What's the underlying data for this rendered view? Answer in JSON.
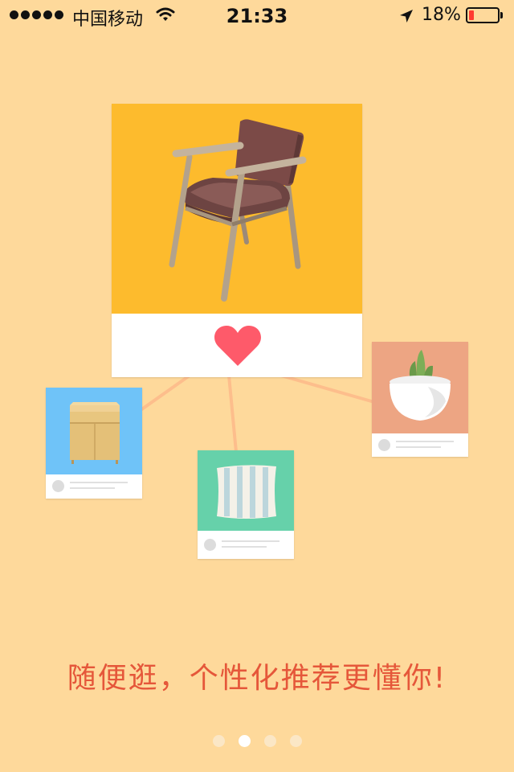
{
  "status_bar": {
    "carrier": "中国移动",
    "time": "21:33",
    "battery_percent": "18%",
    "battery_level": 0.18,
    "signal_bars": 5,
    "icons": [
      "signal-dots-icon",
      "wifi-icon",
      "location-arrow-icon",
      "battery-icon"
    ]
  },
  "onboarding": {
    "tagline": "随便逛，个性化推荐更懂你!",
    "page_count": 4,
    "active_page": 1
  },
  "cards": {
    "main": {
      "image": "armchair",
      "action_icon": "heart-icon"
    },
    "items": [
      "cabinet",
      "pillow",
      "potted-plant"
    ]
  },
  "colors": {
    "background": "#FED99B",
    "main_card_image": "#FDBB2D",
    "heart": "#FE5A6A",
    "cabinet_card": "#6FC3F8",
    "pillow_card": "#66D1AA",
    "plant_card": "#EDA583",
    "tagline": "#E5573A",
    "connector_lines": "#FDBE8C"
  }
}
